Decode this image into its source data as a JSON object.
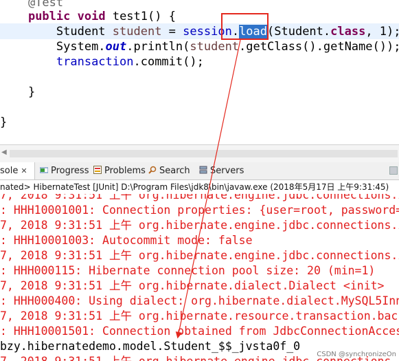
{
  "code": {
    "annotation": "@Test",
    "sig_public": "public",
    "sig_void": "void",
    "sig_name": "test1() {",
    "l1_type": "Student ",
    "l1_var": "student",
    "l1_eq": " = ",
    "l1_session": "session",
    "l1_dot": ".",
    "l1_load": "load",
    "l1_open": "(Student.",
    "l1_class": "class",
    "l1_close": ", 1);",
    "l2_system": "System.",
    "l2_out": "out",
    "l2_println": ".println(",
    "l2_var": "student",
    "l2_rest": ".getClass().getName());",
    "l3_tx": "transaction",
    "l3_rest": ".commit();",
    "brace_inner": "}",
    "brace_outer": "}"
  },
  "tabs": {
    "console": "sole",
    "console_close": "✕",
    "progress": "Progress",
    "problems": "Problems",
    "search": "Search",
    "servers": "Servers"
  },
  "console_header": "nated> HibernateTest [JUnit] D:\\Program Files\\jdk8\\bin\\javaw.exe (2018年5月17日 上午9:31:45)",
  "log_lines": [
    "7, 2018 9:31:51 上午 org.hibernate.engine.jdbc.connections.i",
    ": HHH10001001: Connection properties: {user=root, password=",
    "7, 2018 9:31:51 上午 org.hibernate.engine.jdbc.connections.i",
    ": HHH10001003: Autocommit mode: false",
    "7, 2018 9:31:51 上午 org.hibernate.engine.jdbc.connections.i",
    ": HHH000115: Hibernate connection pool size: 20 (min=1)",
    "7, 2018 9:31:51 上午 org.hibernate.dialect.Dialect <init>",
    ": HHH000400: Using dialect: org.hibernate.dialect.MySQL5Inn",
    "7, 2018 9:31:51 上午 org.hibernate.resource.transaction.back",
    ": HHH10001501: Connection obtained from JdbcConnectionAcces"
  ],
  "output_line": "bzy.hibernatedemo.model.Student_$$_jvsta0f_0",
  "last_log_line": "7, 2018 9:31:51 上午 org.hibernate.engine.jdbc.connections.i",
  "watermark": "CSDN @synchronizeOn",
  "colors": {
    "keyword": "#7f0055",
    "field": "#0000c0",
    "local_var": "#6a3e3e",
    "selection": "#2f73c9",
    "log_error": "#e21e1e",
    "annotation_box": "#e4281e"
  }
}
